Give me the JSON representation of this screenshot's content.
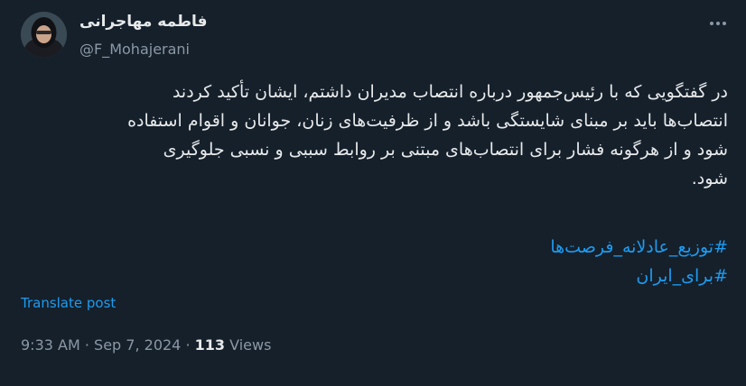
{
  "author": {
    "name": "فاطمه مهاجرانی",
    "handle": "@F_Mohajerani"
  },
  "post": {
    "lines": [
      "در گفتگویی که با رئیس‌جمهور درباره انتصاب مدیران داشتم، ایشان تأکید کردند",
      "انتصاب‌ها باید بر مبنای شایستگی باشد و از ظرفیت‌های زنان، جوانان و اقوام استفاده",
      "شود و از هرگونه فشار برای انتصاب‌های مبتنی بر روابط سببی و نسبی جلوگیری",
      "شود."
    ],
    "hashtags": [
      "#توزیع_عادلانه_فرصت‌ها",
      "#برای_ایران"
    ]
  },
  "translate_label": "Translate post",
  "meta": {
    "time": "9:33 AM",
    "separator": "·",
    "date": "Sep 7, 2024",
    "views_count": "113",
    "views_label": "Views"
  },
  "icons": {
    "more": "more-icon"
  },
  "colors": {
    "background": "#15202b",
    "text": "#e7e9ea",
    "secondary": "#8b98a5",
    "link": "#1d9bf0"
  }
}
